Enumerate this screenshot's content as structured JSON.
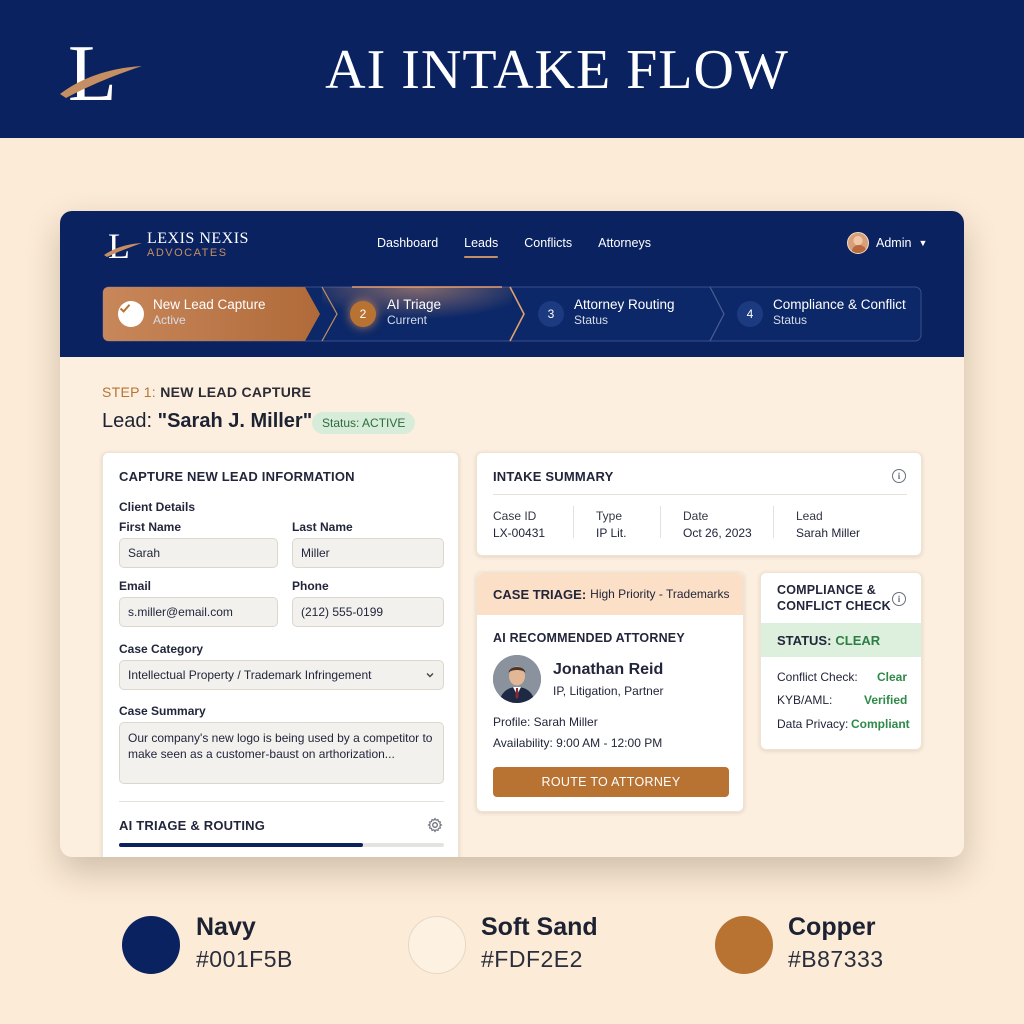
{
  "banner": {
    "logo_letter": "L",
    "title": "AI INTAKE FLOW"
  },
  "app": {
    "brand": {
      "logo_letter": "L",
      "name": "LEXIS NEXIS",
      "sub": "ADVOCATES"
    },
    "nav": [
      {
        "label": "Dashboard",
        "active": false
      },
      {
        "label": "Leads",
        "active": true
      },
      {
        "label": "Conflicts",
        "active": false
      },
      {
        "label": "Attorneys",
        "active": false
      }
    ],
    "user": {
      "name": "Admin"
    },
    "steps": [
      {
        "index": "1",
        "title": "New Lead Capture",
        "status": "Active"
      },
      {
        "index": "2",
        "title": "AI Triage",
        "status": "Current"
      },
      {
        "index": "3",
        "title": "Attorney Routing",
        "status": "Status"
      },
      {
        "index": "4",
        "title": "Compliance & Conflict",
        "status": "Status"
      }
    ],
    "step_heading": {
      "num": "STEP 1:",
      "text": "NEW LEAD CAPTURE"
    },
    "lead": {
      "prefix": "Lead: ",
      "name": "\"Sarah J. Miller\"",
      "status": "Status: ACTIVE"
    },
    "capture": {
      "title": "CAPTURE NEW LEAD INFORMATION",
      "section": "Client Details",
      "first_name_label": "First Name",
      "first_name": "Sarah",
      "last_name_label": "Last Name",
      "last_name": "Miller",
      "email_label": "Email",
      "email": "s.miller@email.com",
      "phone_label": "Phone",
      "phone": "(212) 555-0199",
      "category_label": "Case Category",
      "category": "Intellectual Property / Trademark Infringement",
      "summary_label": "Case Summary",
      "summary": "Our company's new logo is being used by a competitor to make seen as a customer-baust on arthorization...",
      "triage_title": "AI TRIAGE & ROUTING",
      "triage_progress": 0.75
    },
    "summary": {
      "title": "INTAKE SUMMARY",
      "cols": [
        {
          "key": "Case ID",
          "value": "LX-00431"
        },
        {
          "key": "Type",
          "value": "IP Lit."
        },
        {
          "key": "Date",
          "value": "Oct 26, 2023"
        },
        {
          "key": "Lead",
          "value": "Sarah Miller"
        }
      ]
    },
    "triage": {
      "label": "CASE TRIAGE:",
      "value": "High Priority - Trademarks",
      "rec_title": "AI RECOMMENDED ATTORNEY",
      "attorney_name": "Jonathan Reid",
      "attorney_role": "IP, Litigation, Partner",
      "profile": "Profile: Sarah Miller",
      "availability": "Availability: 9:00 AM - 12:00 PM",
      "route_button": "ROUTE TO ATTORNEY"
    },
    "compliance": {
      "title_line1": "COMPLIANCE &",
      "title_line2": "CONFLICT CHECK",
      "status_label": "STATUS:",
      "status_value": "CLEAR",
      "rows": [
        {
          "label": "Conflict Check:",
          "value": "Clear"
        },
        {
          "label": "KYB/AML:",
          "value": "Verified"
        },
        {
          "label": "Data Privacy:",
          "value": "Compliant"
        }
      ]
    }
  },
  "palette": [
    {
      "name": "Navy",
      "hex": "#001F5B",
      "color": "#0A2260"
    },
    {
      "name": "Soft Sand",
      "hex": "#FDF2E2",
      "color": "#FDF2E2"
    },
    {
      "name": "Copper",
      "hex": "#B87333",
      "color": "#B87333"
    }
  ],
  "icons": [
    "check-icon",
    "info-icon",
    "gear-icon",
    "chevron-down-icon",
    "logo-swoosh-icon"
  ]
}
